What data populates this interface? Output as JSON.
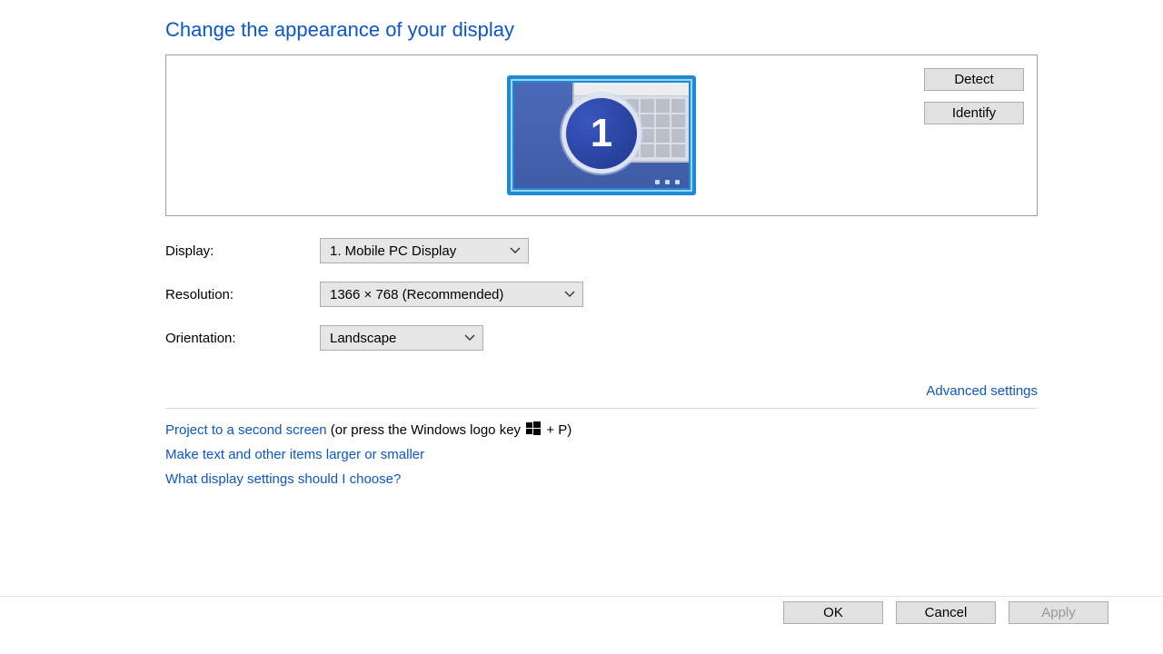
{
  "title": "Change the appearance of your display",
  "monitor_badge": "1",
  "buttons": {
    "detect": "Detect",
    "identify": "Identify",
    "ok": "OK",
    "cancel": "Cancel",
    "apply": "Apply"
  },
  "labels": {
    "display": "Display:",
    "resolution": "Resolution:",
    "orientation": "Orientation:"
  },
  "dropdowns": {
    "display": "1. Mobile PC Display",
    "resolution": "1366 × 768 (Recommended)",
    "orientation": "Landscape"
  },
  "links": {
    "advanced": "Advanced settings",
    "project": "Project to a second screen",
    "project_suffix_a": " (or press the Windows logo key ",
    "project_suffix_b": " + P)",
    "text_size": "Make text and other items larger or smaller",
    "help": "What display settings should I choose?"
  }
}
